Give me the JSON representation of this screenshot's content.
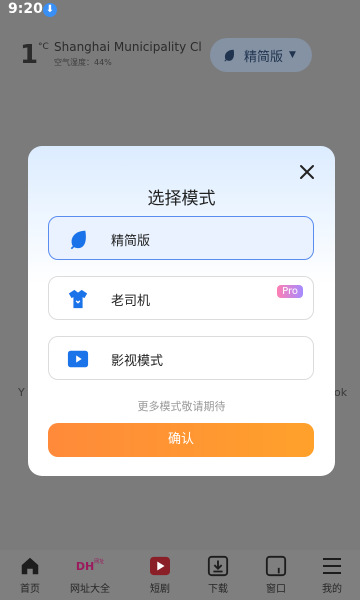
{
  "status_bar": {
    "time": "9:20",
    "download_glyph": "⬇"
  },
  "weather": {
    "temperature": "1",
    "unit": "°C",
    "city": "Shanghai Municipality",
    "city_suffix": "Cl",
    "humidity_label": "空气湿度：44%"
  },
  "mode_pill": {
    "label": "精简版"
  },
  "background_fragments": {
    "left": "Y",
    "right": "ok"
  },
  "modal": {
    "title": "选择模式",
    "options": [
      {
        "label": "精简版",
        "selected": true,
        "icon": "leaf-icon"
      },
      {
        "label": "老司机",
        "selected": false,
        "icon": "shirt-icon",
        "badge": "Pro"
      },
      {
        "label": "影视模式",
        "selected": false,
        "icon": "video-play-icon"
      }
    ],
    "more_hint": "更多模式敬请期待",
    "confirm_label": "确认"
  },
  "bottom_nav": [
    {
      "label": "首页",
      "icon": "home-icon"
    },
    {
      "label": "网址大全",
      "icon": "dh-logo-icon",
      "logo_text": "DH",
      "logo_sup": "网址"
    },
    {
      "label": "短剧",
      "icon": "play-icon"
    },
    {
      "label": "下载",
      "icon": "download-icon"
    },
    {
      "label": "窗口",
      "icon": "window-icon"
    },
    {
      "label": "我的",
      "icon": "menu-icon"
    }
  ],
  "colors": {
    "accent_blue": "#5b8def",
    "confirm_orange": "#ff8a3a",
    "icon_blue": "#1a73e8"
  }
}
